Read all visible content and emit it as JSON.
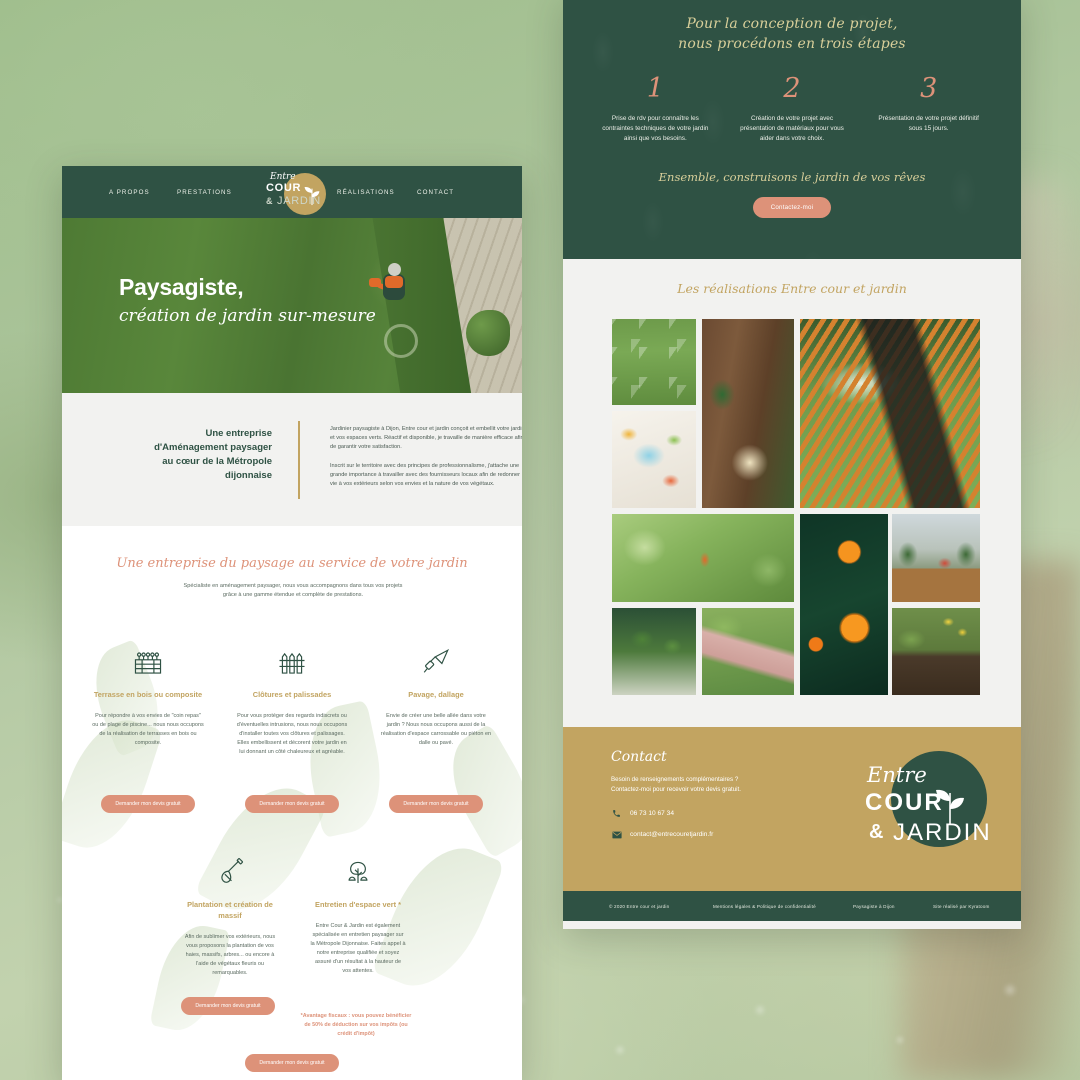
{
  "brand": {
    "name_line1": "Entre",
    "name_line2": "COUR",
    "amp": "&",
    "name_line3": "JARDIN",
    "colors": {
      "dark_green": "#2f5244",
      "gold": "#c2a461",
      "salmon": "#dd9279",
      "cream": "#d8cf9a",
      "light_grey": "#f2f2f0"
    }
  },
  "nav": {
    "items": [
      {
        "label": "A PROPOS"
      },
      {
        "label": "PRESTATIONS"
      },
      {
        "label": "RÉALISATIONS"
      },
      {
        "label": "CONTACT"
      }
    ]
  },
  "hero": {
    "title": "Paysagiste,",
    "subtitle": "création de jardin sur-mesure"
  },
  "intro": {
    "heading": "Une entreprise d'Aménagement paysager au cœur de la Métropole dijonnaise",
    "paragraph1": "Jardinier paysagiste à Dijon, Entre cour et jardin conçoit et embellit votre jardin et vos espaces verts. Réactif et disponible, je travaille de manière efficace afin de garantir votre satisfaction.",
    "paragraph2": "Inscrit sur le territoire avec des principes de professionnalisme, j'attache une grande importance à travailler avec des fournisseurs locaux afin de redonner vie à vos extérieurs selon vos envies et la nature de vos végétaux."
  },
  "services": {
    "title": "Une entreprise du paysage au service de votre jardin",
    "subtitle": "Spécialiste en aménagement paysager, nous vous accompagnons dans tous vos projets grâce à une gamme étendue et complète de prestations.",
    "cta_label": "Demander mon devis gratuit",
    "items": [
      {
        "icon": "deck-terrace-icon",
        "name": "Terrasse en bois ou composite",
        "desc": "Pour répondre à vos envies de \"coin repas\" ou de plage de piscine... nous nous occupons de la réalisation de terrasses en bois ou composite."
      },
      {
        "icon": "fence-icon",
        "name": "Clôtures et palissades",
        "desc": "Pour vous protéger des regards indiscrets ou d'éventuelles intrusions, nous nous occupons d'installer toutes vos clôtures et palissages. Elles embellissent et décorent votre jardin en lui donnant un côté chaleureux et agréable."
      },
      {
        "icon": "trowel-icon",
        "name": "Pavage, dallage",
        "desc": "Envie de créer une belle allée dans votre jardin ? Nous nous occupons aussi de la réalisation d'espace carrossable ou piéton en dalle ou pavé."
      },
      {
        "icon": "shovel-icon",
        "name": "Plantation et création de massif",
        "desc": "Afin de sublimer vos extérieurs, nous vous proposons la plantation de vos haies, massifs, arbres... ou encore à l'aide de végétaux fleuris ou remarquables."
      },
      {
        "icon": "tree-icon",
        "name": "Entretien d'espace vert *",
        "desc": "Entre Cour & Jardin est également spécialisée en entretien paysager sur la Métropole Dijonnaise. Faites appel à notre entreprise qualifiée et soyez assuré d'un résultat à la hauteur de vos attentes."
      }
    ],
    "footnote": "*Avantage fiscaux : vous pouvez bénéficier de 50% de déduction sur vos impôts (ou crédit d'impôt)"
  },
  "process": {
    "title_line1": "Pour la conception de projet,",
    "title_line2": "nous procédons en trois étapes",
    "steps": [
      {
        "number": "1",
        "text": "Prise de rdv pour connaître les contraintes techniques de votre jardin ainsi que vos besoins."
      },
      {
        "number": "2",
        "text": "Création de votre projet avec présentation de matériaux pour vous aider dans votre choix."
      },
      {
        "number": "3",
        "text": "Présentation de votre projet définitif sous 15 jours."
      }
    ]
  },
  "cta": {
    "title": "Ensemble, construisons le jardin de vos rêves",
    "button_label": "Contactez-moi"
  },
  "realisations": {
    "title": "Les réalisations Entre cour et jardin",
    "tiles": [
      {
        "name": "stone-stepping-path-photo"
      },
      {
        "name": "garden-plan-drawing-photo"
      },
      {
        "name": "gloves-and-tools-photo"
      },
      {
        "name": "wheelbarrow-bench-photo"
      },
      {
        "name": "gardener-at-work-photo"
      },
      {
        "name": "trimmed-bushes-photo"
      },
      {
        "name": "pink-paved-path-photo"
      },
      {
        "name": "orange-marigold-flowers-photo"
      },
      {
        "name": "wooden-terrace-planter-photo"
      },
      {
        "name": "daffodils-planting-photo"
      }
    ]
  },
  "contact": {
    "title": "Contact",
    "subtitle_line1": "Besoin de renseignements complémentaires ?",
    "subtitle_line2": "Contactez-moi pour recevoir votre devis gratuit.",
    "phone": "06 73 10 67 34",
    "email": "contact@entrecouretjardin.fr",
    "phone_icon": "phone-icon",
    "email_icon": "envelope-icon"
  },
  "footer": {
    "copyright": "© 2020 Entre cour et jardin",
    "legal": "Mentions légales & Politique de confidentialité",
    "seo": "Paysagiste à Dijon",
    "credit": "Site réalisé par Kyratoom"
  }
}
